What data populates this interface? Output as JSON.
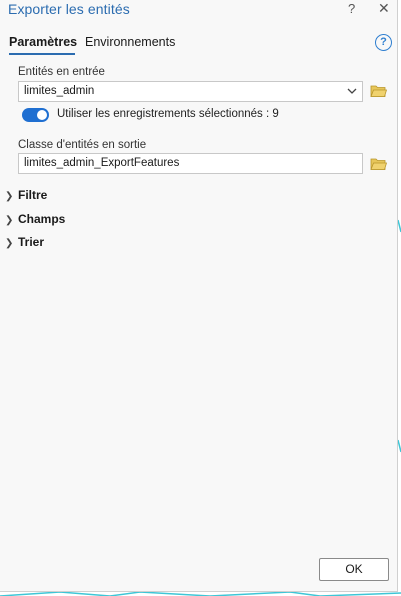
{
  "window": {
    "title": "Exporter les entités",
    "help_glyph": "?",
    "close_glyph": "✕"
  },
  "tabs": [
    {
      "label": "Paramètres",
      "active": true
    },
    {
      "label": "Environnements",
      "active": false
    }
  ],
  "help_icon_glyph": "?",
  "params": {
    "input_features": {
      "label": "Entités en entrée",
      "value": "limites_admin"
    },
    "use_selected": {
      "label": "Utiliser les enregistrements sélectionnés : 9",
      "enabled": true
    },
    "output_class": {
      "label": "Classe d'entités en sortie",
      "value": "limites_admin_ExportFeatures"
    }
  },
  "sections": [
    {
      "label": "Filtre",
      "expanded": false
    },
    {
      "label": "Champs",
      "expanded": false
    },
    {
      "label": "Trier",
      "expanded": false
    }
  ],
  "footer": {
    "ok_label": "OK"
  },
  "colors": {
    "accent": "#2b6cb0",
    "toggle": "#1f6fd1",
    "folder": "#d8b84a",
    "map_lines": "#3ec6d6"
  },
  "icons": [
    "help-circle-icon",
    "folder-icon",
    "chevron-down-icon",
    "chevron-right-icon",
    "close-icon"
  ]
}
